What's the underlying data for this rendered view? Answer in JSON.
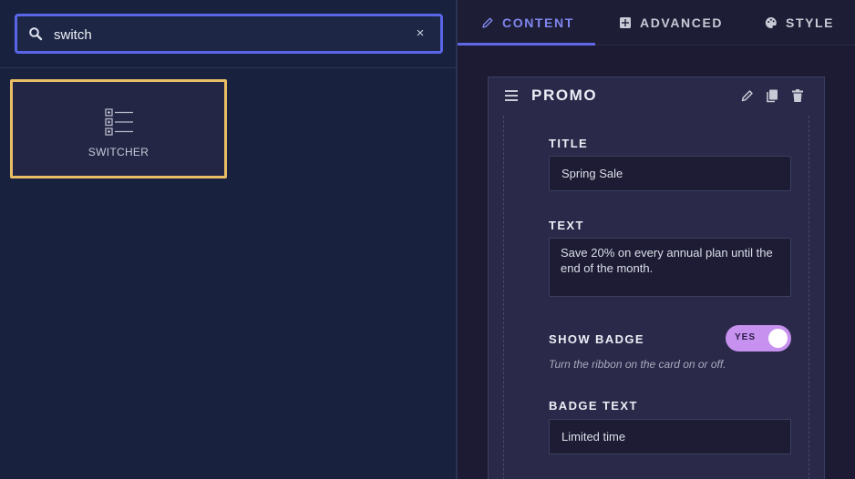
{
  "search": {
    "value": "switch",
    "clear_label": "×"
  },
  "widgets": [
    {
      "label": "SWITCHER",
      "icon": "list-checkbox-icon"
    }
  ],
  "tabs": [
    {
      "label": "CONTENT",
      "icon": "pencil-icon",
      "active": true
    },
    {
      "label": "ADVANCED",
      "icon": "grid-icon",
      "active": false
    },
    {
      "label": "STYLE",
      "icon": "palette-icon",
      "active": false
    }
  ],
  "card": {
    "title": "PROMO",
    "fields": {
      "title": {
        "label": "TITLE",
        "value": "Spring Sale"
      },
      "text": {
        "label": "TEXT",
        "value": "Save 20% on every annual plan until the end of the month."
      },
      "show_badge": {
        "label": "SHOW BADGE",
        "toggle_text": "YES",
        "help": "Turn the ribbon on the card on or off.",
        "on": true
      },
      "badge_text": {
        "label": "BADGE TEXT",
        "value": "Limited time"
      }
    }
  },
  "colors": {
    "accent": "#5f68e6",
    "widget_highlight": "#e8bd64",
    "toggle_on": "#c691ef"
  }
}
